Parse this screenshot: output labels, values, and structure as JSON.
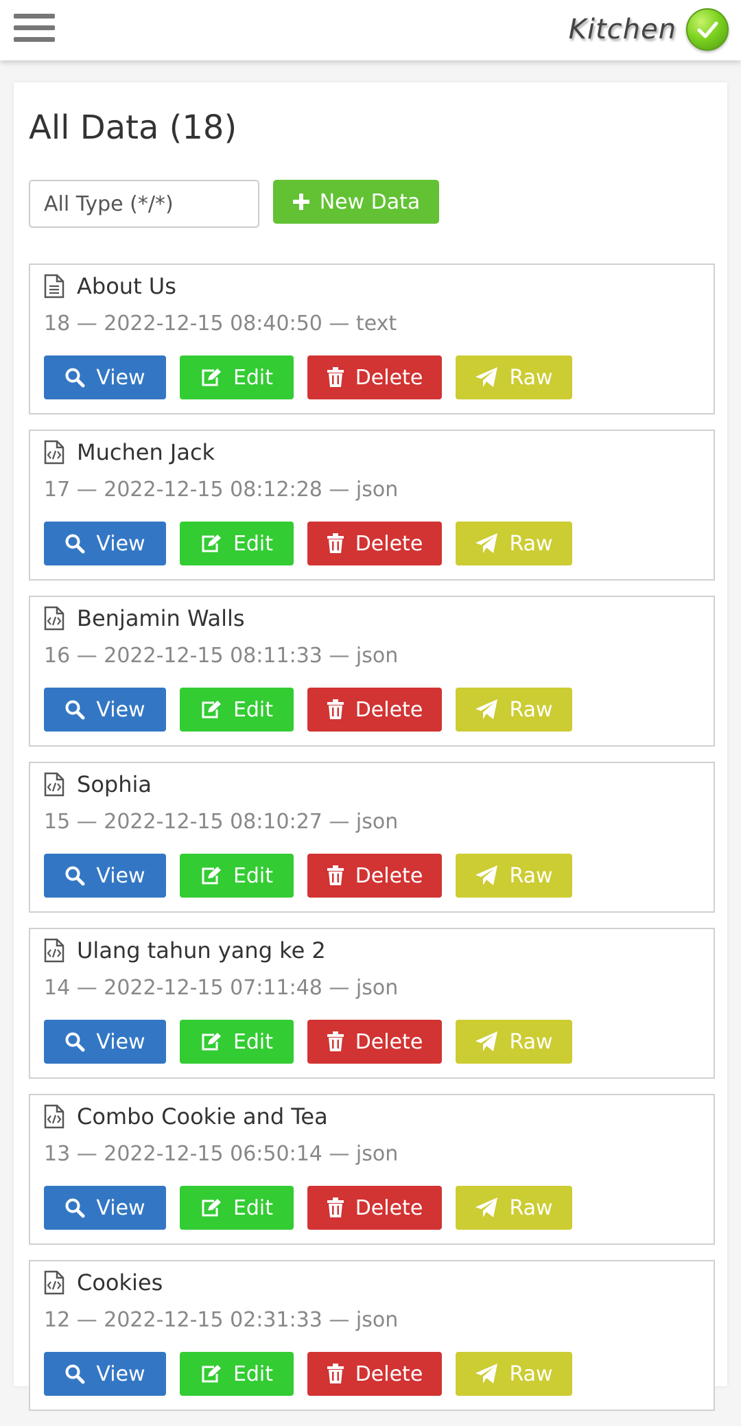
{
  "header": {
    "logo_text": "Kitchen",
    "menu_icon": "hamburger-menu-icon",
    "logo_icon": "check-circle-icon"
  },
  "main": {
    "title": "All Data (18)",
    "type_filter": {
      "selected": "All Type (*/*)"
    },
    "new_button": {
      "label": "New Data",
      "icon": "plus-icon"
    },
    "actions": {
      "view": "View",
      "edit": "Edit",
      "delete": "Delete",
      "raw": "Raw"
    },
    "items": [
      {
        "title": "About Us",
        "meta": "18 — 2022-12-15 08:40:50 — text",
        "icon": "file-text-icon"
      },
      {
        "title": "Muchen Jack",
        "meta": "17 — 2022-12-15 08:12:28 — json",
        "icon": "file-code-icon"
      },
      {
        "title": "Benjamin Walls",
        "meta": "16 — 2022-12-15 08:11:33 — json",
        "icon": "file-code-icon"
      },
      {
        "title": "Sophia",
        "meta": "15 — 2022-12-15 08:10:27 — json",
        "icon": "file-code-icon"
      },
      {
        "title": "Ulang tahun yang ke 2",
        "meta": "14 — 2022-12-15 07:11:48 — json",
        "icon": "file-code-icon"
      },
      {
        "title": "Combo Cookie and Tea",
        "meta": "13 — 2022-12-15 06:50:14 — json",
        "icon": "file-code-icon"
      },
      {
        "title": "Cookies",
        "meta": "12 — 2022-12-15 02:31:33 — json",
        "icon": "file-code-icon"
      }
    ]
  },
  "colors": {
    "view": "#3377c4",
    "edit": "#33cc33",
    "delete": "#d23333",
    "raw": "#cccc33",
    "new": "#62c233"
  }
}
